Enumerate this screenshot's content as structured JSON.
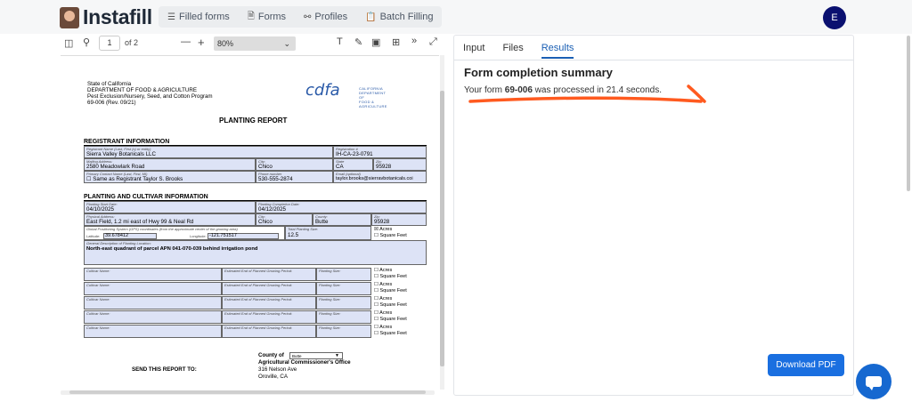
{
  "app": {
    "name": "Instafill",
    "avatar_initial": "E"
  },
  "nav": [
    {
      "icon": "stack-icon",
      "label": "Filled forms"
    },
    {
      "icon": "document-icon",
      "label": "Forms"
    },
    {
      "icon": "people-icon",
      "label": "Profiles"
    },
    {
      "icon": "clipboard-icon",
      "label": "Batch Filling"
    }
  ],
  "pdf_toolbar": {
    "page": "1",
    "of_pages": "of 2",
    "zoom": "80%"
  },
  "document": {
    "agency_1": "State of California",
    "agency_2": "DEPARTMENT OF FOOD & AGRICULTURE",
    "agency_3": "Pest Exclusion/Nursery, Seed, and Cotton Program",
    "agency_4": "69-006 (Rev. 09/21)",
    "logo_text": "cdfa",
    "logo_sub_1": "CALIFORNIA DEPARTMENT OF",
    "logo_sub_2": "FOOD & AGRICULTURE",
    "report_title": "PLANTING REPORT",
    "section_registrant": "REGISTRANT INFORMATION",
    "lbl_reg_name": "Registrant Name (Last, First (s) or entity)",
    "val_reg_name": "Sierra Valley Botanicals LLC",
    "lbl_reg_no": "Registration #",
    "val_reg_no": "IH-CA-23-0791",
    "lbl_mailing": "Mailing Address:",
    "val_mailing": "2580 Meadowlark Road",
    "lbl_city": "City:",
    "val_city": "Chico",
    "lbl_state": "State",
    "val_state": "CA",
    "lbl_zip": "Zip:",
    "val_zip": "95928",
    "lbl_contact": "Primary Contact Name (Last, First, MI)",
    "val_contact": "☐ Same as Registrant  Taylor S. Brooks",
    "lbl_phone": "Phone number",
    "val_phone": "530-555-2874",
    "lbl_email": "Email (optional)",
    "val_email": "taylor.brooks@sierravbotanicals.coi",
    "section_planting": "PLANTING AND CULTIVAR INFORMATION",
    "lbl_start": "Planting Start Date:",
    "val_start": "04/10/2025",
    "lbl_completion": "Planting Completion Date:",
    "val_completion": "04/12/2025",
    "lbl_phys": "Physical Address:",
    "val_phys": "East Field, 1.2 mi east of Hwy 99 & Neal Rd",
    "lbl_city2": "City:",
    "val_city2": "Chico",
    "lbl_county": "County:",
    "val_county": "Butte",
    "lbl_zip2": "Zip:",
    "val_zip2": "95928",
    "lbl_gps": "Global Positioning System (GPS) coordinates (from the approximate center of the growing area)",
    "lbl_total_size": "Total Planting Size:",
    "lbl_lat": "Latitude:",
    "val_lat": "39.678412",
    "lbl_lon": "Longitude:",
    "val_lon": "-121.751517",
    "val_size": "12.5",
    "acres": "Acres",
    "sqft": "Square Feet",
    "acres_checked": "☒",
    "unchecked": "☐",
    "lbl_desc": "General Description of Planting Location:",
    "val_desc": "North-east quadrant of parcel APN 041-070-039 behind irrigation pond",
    "lbl_cultivar": "Cultivar Name:",
    "lbl_growing": "Estimated End of Planned Growing Period:",
    "lbl_psize": "Planting Size:",
    "send_to": "SEND THIS REPORT TO:",
    "county_of": "County of",
    "county_sel": "Butte",
    "office": "Agricultural Commissioner's Office",
    "addr1": "316 Nelson Ave",
    "addr2": "Oroville, CA"
  },
  "results": {
    "tabs": [
      "Input",
      "Files",
      "Results"
    ],
    "active_tab": "Results",
    "title": "Form completion summary",
    "text_pre": "Your form ",
    "form_id": "69-006",
    "text_post": " was processed in 21.4 seconds.",
    "download": "Download PDF"
  },
  "colors": {
    "accent": "#1a6fe0",
    "annotation": "#ff5a1f",
    "avatar": "#0a1070"
  }
}
